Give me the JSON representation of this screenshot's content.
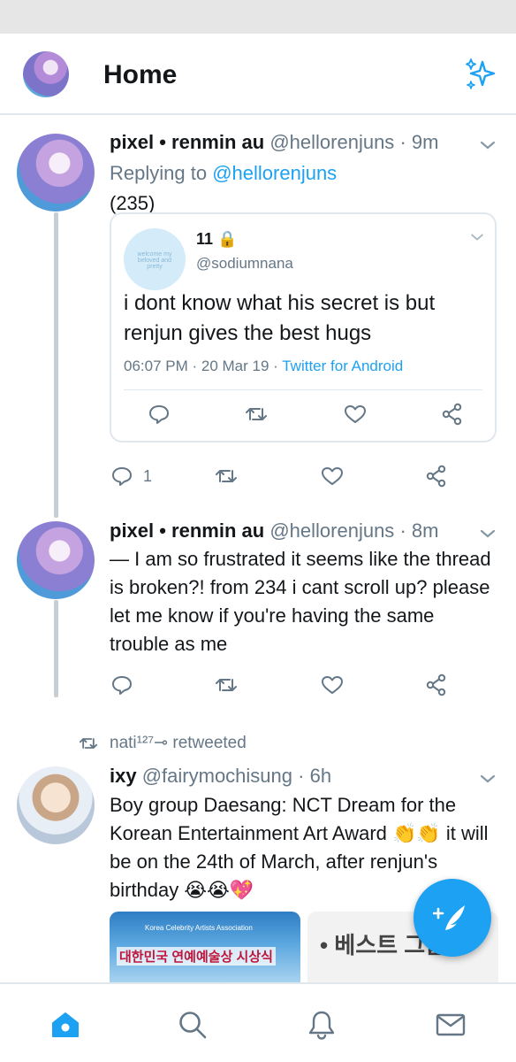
{
  "header": {
    "title": "Home"
  },
  "tweets": [
    {
      "name": "pixel • renmin au",
      "handle": "@hellorenjuns",
      "time": "· 9m",
      "replying_prefix": "Replying to",
      "replying_handle": "@hellorenjuns",
      "text": "(235)",
      "quote": {
        "name": "11 🔒",
        "handle": "@sodiumnana",
        "avatar_text": "welcome my beloved and pretty",
        "text": "i dont know what his secret is but renjun gives the best hugs",
        "meta": "06:07 PM · 20 Mar 19 ·",
        "source": "Twitter for Android"
      },
      "reply_count": "1"
    },
    {
      "name": "pixel • renmin au",
      "handle": "@hellorenjuns",
      "time": "· 8m",
      "text": "— I am so frustrated it seems like the thread is broken?! from 234 i cant scroll up? please let me know if you're having the same trouble as me"
    },
    {
      "retweeted_by": "nati¹²⁷⊸ retweeted",
      "name": "ixy",
      "handle": "@fairymochisung",
      "time": "· 6h",
      "text": "Boy group Daesang: NCT Dream for the Korean Entertainment Art Award 👏👏 it will be on the 24th of March, after renjun's birthday 😭😭💖",
      "media": [
        {
          "title": "대한민국 연예예술상 시상식",
          "caption": "Korea Celebrity Artists Association"
        },
        {
          "title": "• 베스트 그룹상"
        }
      ]
    }
  ],
  "colors": {
    "accent": "#1da1f2",
    "muted": "#657786",
    "text": "#14171a",
    "border": "#e1e8ed"
  },
  "icons": [
    "sparkle-icon",
    "chevron-down-icon",
    "reply-icon",
    "retweet-icon",
    "like-icon",
    "share-icon",
    "compose-icon",
    "home-icon",
    "search-icon",
    "notifications-icon",
    "messages-icon"
  ]
}
